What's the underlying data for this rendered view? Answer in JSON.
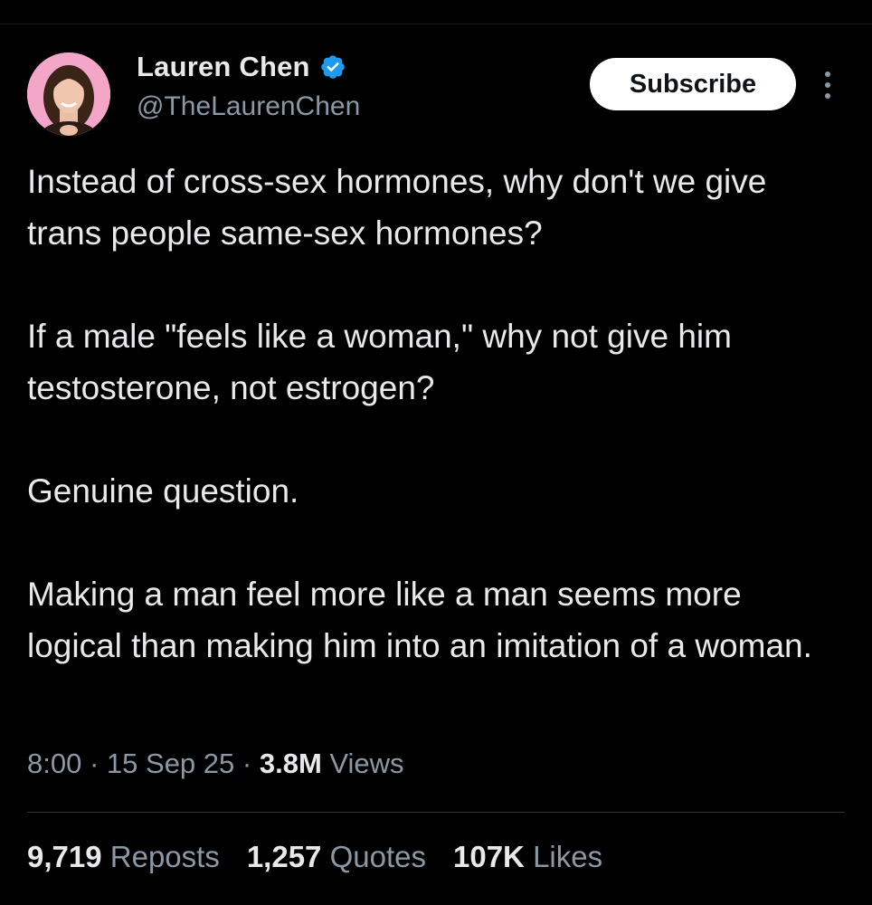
{
  "author": {
    "display_name": "Lauren Chen",
    "handle": "@TheLaurenChen"
  },
  "header": {
    "subscribe_label": "Subscribe"
  },
  "tweet": {
    "paragraphs": [
      "Instead of cross-sex hormones, why don't we give trans people same-sex hormones?",
      "If a male \"feels like a woman,\" why not give him testosterone, not estrogen?",
      "Genuine question.",
      "Making a man feel more like a man seems more logical than making him into an imitation of a woman."
    ]
  },
  "meta": {
    "time": "8:00",
    "separator": "·",
    "date": "15 Sep 25",
    "views_count": "3.8M",
    "views_label": "Views"
  },
  "stats": {
    "reposts_count": "9,719",
    "reposts_label": "Reposts",
    "quotes_count": "1,257",
    "quotes_label": "Quotes",
    "likes_count": "107K",
    "likes_label": "Likes"
  },
  "colors": {
    "background": "#000000",
    "text_primary": "#e7e9ea",
    "text_secondary": "#8b98a5",
    "verified_badge": "#1d9bf0",
    "button_bg": "#ffffff"
  },
  "icons": {
    "verified": "verified-badge-icon",
    "more": "more-vertical-icon"
  }
}
